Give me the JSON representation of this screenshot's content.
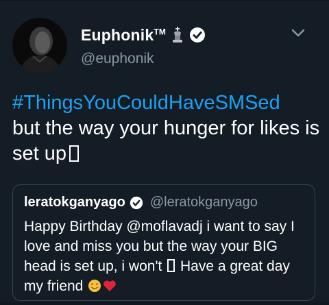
{
  "tweet": {
    "author": {
      "display_name": "Euphonik",
      "trademark": "TM",
      "handle": "@euphonik",
      "avatar_icon": "avatar-dark-portrait",
      "verified_icon": "verified-badge-icon",
      "badge_icon": "chess-king-icon"
    },
    "menu_icon": "chevron-down-icon",
    "hashtag": "#ThingsYouCouldHaveSMSed",
    "text": "but the way your hunger for likes is set up",
    "quoted": {
      "display_name": "leratokganyago",
      "handle": "@leratokganyago",
      "text_part1": "Happy Birthday @moflavadj i want to say I love and miss you but the way your BIG head is set up, i won't",
      "text_part2": "Have a great day my friend",
      "emoji": [
        "smiling-face-icon",
        "red-heart-icon"
      ]
    }
  },
  "colors": {
    "background": "#141d26",
    "text": "#ffffff",
    "secondary_text": "#8899a6",
    "link": "#1da1f2",
    "card_border": "#38444d"
  }
}
